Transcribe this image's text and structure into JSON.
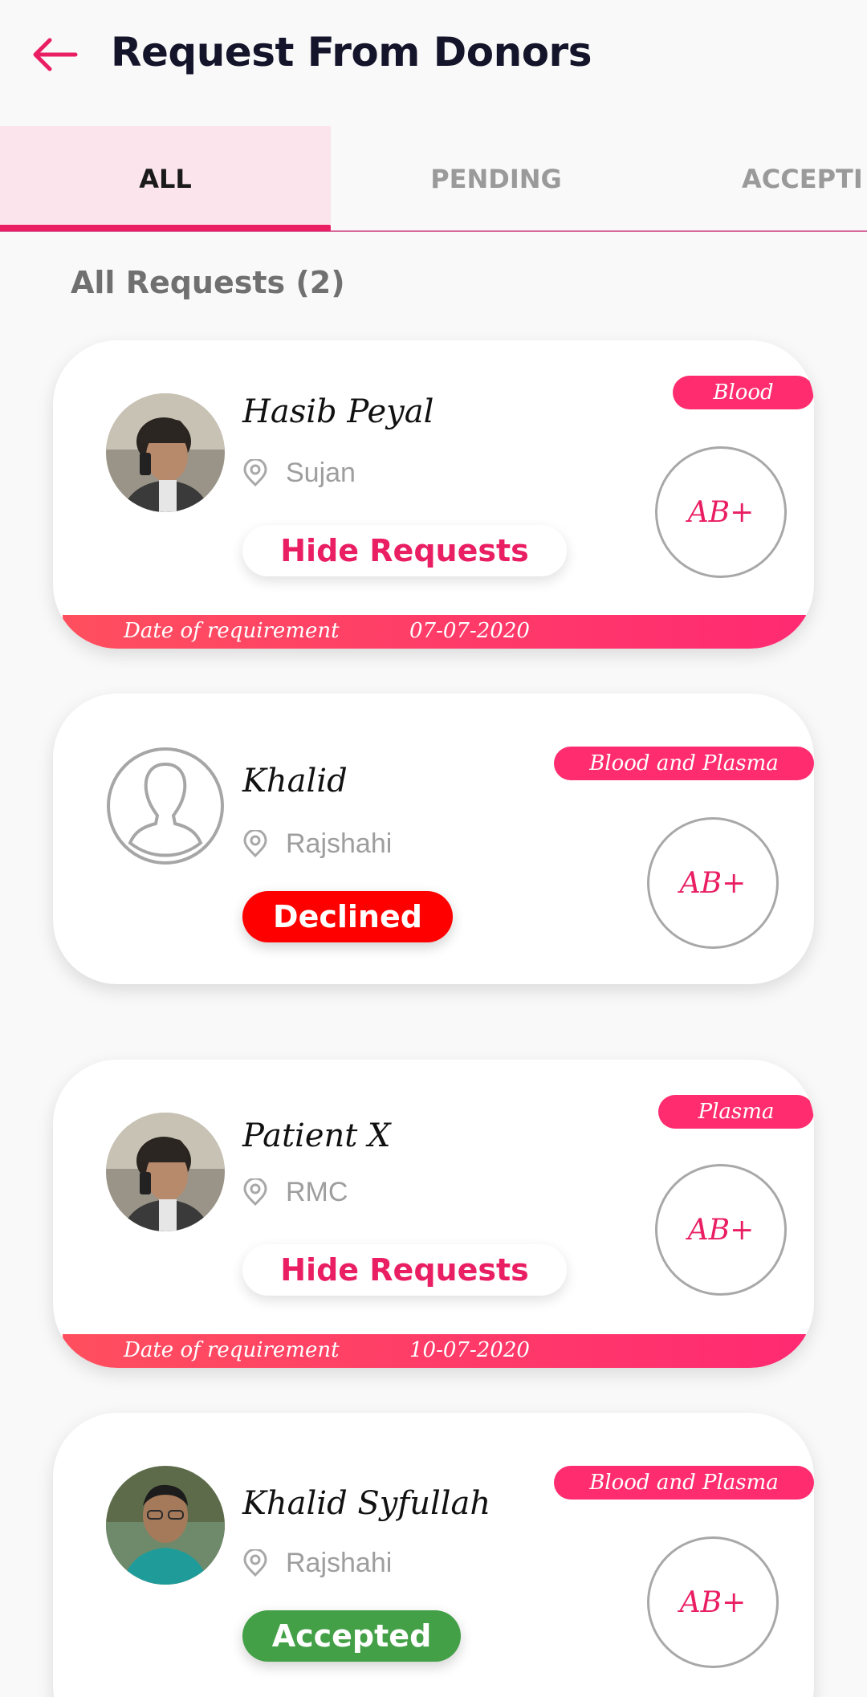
{
  "header": {
    "title": "Request From Donors",
    "back_icon": "arrow-left-icon"
  },
  "tabs": [
    {
      "label": "ALL",
      "active": true
    },
    {
      "label": "PENDING",
      "active": false
    },
    {
      "label": "ACCEPTI",
      "active": false
    }
  ],
  "section": {
    "title": "All Requests (2)"
  },
  "colors": {
    "accent": "#e91e63",
    "declined": "#ff0000",
    "accepted": "#43a047",
    "badge": "#ff2d6f"
  },
  "requests": [
    {
      "name": "Hasib Peyal",
      "location": "Sujan",
      "type": "Blood",
      "blood_group": "AB+",
      "action": "Hide Requests",
      "date_label": "Date of requirement",
      "date": "07-07-2020",
      "avatar": "photo"
    },
    {
      "name": "Khalid",
      "location": "Rajshahi",
      "type": "Blood and Plasma",
      "blood_group": "AB+",
      "status": "Declined",
      "avatar": "placeholder"
    },
    {
      "name": "Patient X",
      "location": "RMC",
      "type": "Plasma",
      "blood_group": "AB+",
      "action": "Hide Requests",
      "date_label": "Date of requirement",
      "date": "10-07-2020",
      "avatar": "photo"
    },
    {
      "name": "Khalid Syfullah",
      "location": "Rajshahi",
      "type": "Blood and Plasma",
      "blood_group": "AB+",
      "status": "Accepted",
      "avatar": "photo"
    }
  ]
}
